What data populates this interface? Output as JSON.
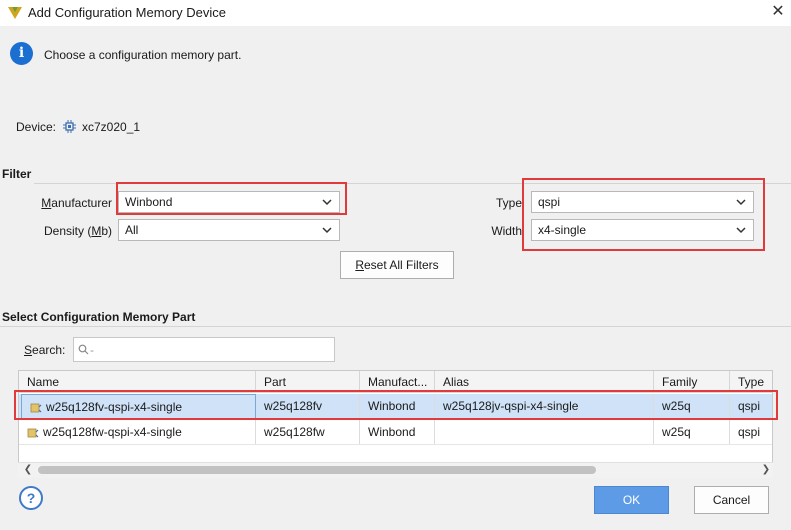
{
  "window": {
    "title": "Add Configuration Memory Device",
    "close_glyph": "✕"
  },
  "info": {
    "icon": "info-icon",
    "message": "Choose a configuration memory part."
  },
  "device": {
    "label": "Device:",
    "icon": "chip-icon",
    "value": "xc7z020_1"
  },
  "filter": {
    "title": "Filter",
    "manufacturer": {
      "label_prefix": "M",
      "label_rest": "anufacturer",
      "value": "Winbond"
    },
    "density": {
      "label_main": "Density (",
      "label_mnemonic": "M",
      "label_end": "b)",
      "value": "All"
    },
    "type": {
      "label": "Type",
      "value": "qspi"
    },
    "width": {
      "label": "Width",
      "value": "x4-single"
    },
    "reset_button": {
      "mnemonic": "R",
      "rest": "eset All Filters"
    }
  },
  "select_part": {
    "title": "Select Configuration Memory Part",
    "search_label_mnemonic": "S",
    "search_label_rest": "earch:",
    "search_placeholder": "Q-",
    "columns": [
      "Name",
      "Part",
      "Manufact...",
      "Alias",
      "Family",
      "Type"
    ],
    "rows": [
      {
        "name": "w25q128fv-qspi-x4-single",
        "part": "w25q128fv",
        "manufacturer": "Winbond",
        "alias": "w25q128jv-qspi-x4-single",
        "family": "w25q",
        "type": "qspi",
        "selected": true
      },
      {
        "name": "w25q128fw-qspi-x4-single",
        "part": "w25q128fw",
        "manufacturer": "Winbond",
        "alias": "",
        "family": "w25q",
        "type": "qspi",
        "selected": false
      }
    ]
  },
  "buttons": {
    "help": "?",
    "ok": "OK",
    "cancel": "Cancel"
  },
  "colors": {
    "accent_blue": "#5e9be6",
    "highlight_red": "#e03a3a",
    "selected_row": "#cfe2f7"
  }
}
